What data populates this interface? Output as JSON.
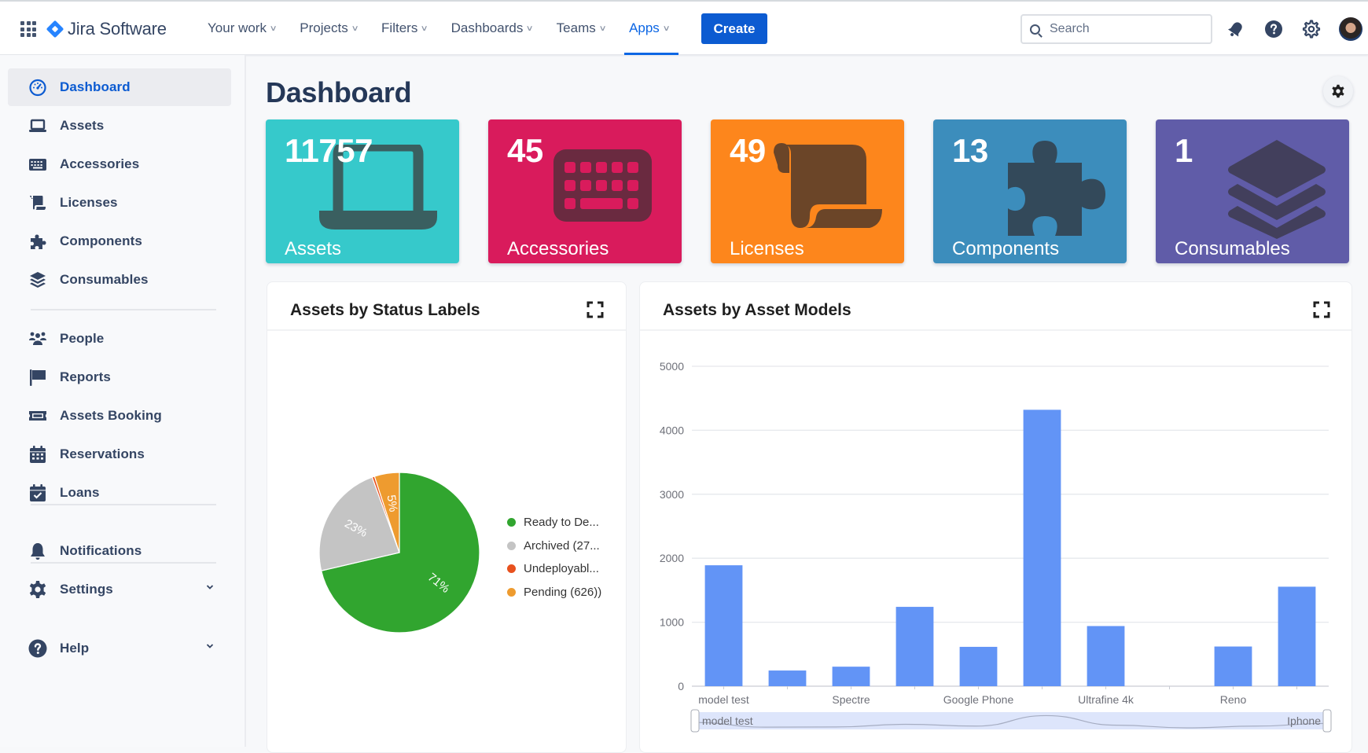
{
  "app": {
    "brand": "Jira Software",
    "nav": [
      {
        "label": "Your work",
        "active": false
      },
      {
        "label": "Projects",
        "active": false
      },
      {
        "label": "Filters",
        "active": false
      },
      {
        "label": "Dashboards",
        "active": false
      },
      {
        "label": "Teams",
        "active": false
      },
      {
        "label": "Apps",
        "active": true
      }
    ],
    "create_label": "Create",
    "search_placeholder": "Search",
    "icons": [
      "notifications-icon",
      "help-icon",
      "settings-icon",
      "profile-avatar"
    ]
  },
  "sidebar": {
    "items": [
      {
        "label": "Dashboard",
        "icon": "dashboard-gauge-icon",
        "active": true
      },
      {
        "label": "Assets",
        "icon": "laptop-icon"
      },
      {
        "label": "Accessories",
        "icon": "keyboard-icon"
      },
      {
        "label": "Licenses",
        "icon": "scroll-icon"
      },
      {
        "label": "Components",
        "icon": "puzzle-icon"
      },
      {
        "label": "Consumables",
        "icon": "layers-icon"
      },
      {
        "label": "People",
        "icon": "people-icon"
      },
      {
        "label": "Reports",
        "icon": "flag-icon"
      },
      {
        "label": "Assets Booking",
        "icon": "ticket-icon"
      },
      {
        "label": "Reservations",
        "icon": "calendar-icon"
      },
      {
        "label": "Loans",
        "icon": "calendar-check-icon"
      },
      {
        "label": "Notifications",
        "icon": "bell-icon"
      },
      {
        "label": "Settings",
        "icon": "gear-icon",
        "expandable": true
      },
      {
        "label": "Help",
        "icon": "question-icon",
        "expandable": true
      }
    ]
  },
  "main": {
    "title": "Dashboard",
    "cards": [
      {
        "value": "11757",
        "label": "Assets",
        "color": "#36c9cb",
        "icon": "laptop-icon"
      },
      {
        "value": "45",
        "label": "Accessories",
        "color": "#d91b5c",
        "icon": "keyboard-icon"
      },
      {
        "value": "49",
        "label": "Licenses",
        "color": "#fd861c",
        "icon": "scroll-icon"
      },
      {
        "value": "13",
        "label": "Components",
        "color": "#3c8dbc",
        "icon": "puzzle-icon"
      },
      {
        "value": "1",
        "label": "Consumables",
        "color": "#605ca8",
        "icon": "layers-icon"
      }
    ],
    "panels": {
      "status": {
        "title": "Assets by Status Labels"
      },
      "models": {
        "title": "Assets by Asset Models"
      }
    }
  },
  "chart_data": [
    {
      "type": "pie",
      "title": "Assets by Status Labels",
      "legend_position": "right",
      "slices": [
        {
          "label": "Ready to De...",
          "percent": 71,
          "color": "#31a52f"
        },
        {
          "label": "Archived (27...",
          "percent": 23,
          "color": "#c4c4c4"
        },
        {
          "label": "Undeployabl...",
          "percent": 0.5,
          "color": "#e8511e"
        },
        {
          "label": "Pending (626))",
          "percent": 5,
          "color": "#ee9b2f"
        }
      ],
      "data_labels": [
        "71%",
        "23%",
        "5%"
      ]
    },
    {
      "type": "bar",
      "title": "Assets by Asset Models",
      "categories": [
        "model test",
        "",
        "Spectre",
        "",
        "Google Phone",
        "",
        "Ultrafine 4k",
        "",
        "Reno",
        "Iphone"
      ],
      "values": [
        1890,
        245,
        305,
        1240,
        615,
        4320,
        940,
        0,
        620,
        1555
      ],
      "ylim": [
        0,
        5000
      ],
      "yticks": [
        0,
        1000,
        2000,
        3000,
        4000,
        5000
      ],
      "grid": true,
      "bar_color": "#6294f6",
      "datazoom": {
        "start_label": "model test",
        "end_label": "Iphone"
      }
    }
  ]
}
